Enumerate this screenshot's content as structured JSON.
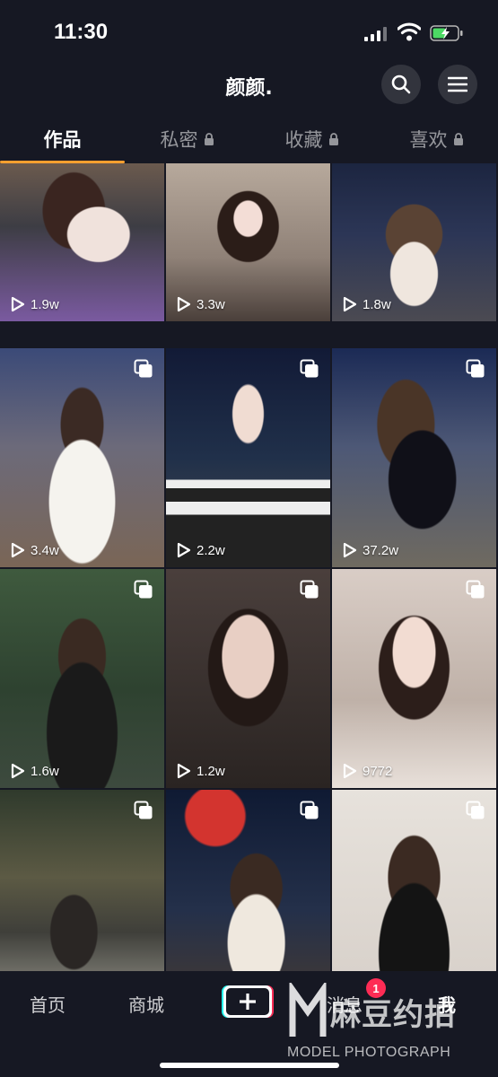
{
  "status_bar": {
    "time": "11:30"
  },
  "header": {
    "title": "颜颜."
  },
  "tabs": [
    {
      "label": "作品",
      "locked": false
    },
    {
      "label": "私密",
      "locked": true
    },
    {
      "label": "收藏",
      "locked": true
    },
    {
      "label": "喜欢",
      "locked": true
    }
  ],
  "videos": [
    {
      "views": "1.9w",
      "multi": false
    },
    {
      "views": "3.3w",
      "multi": false
    },
    {
      "views": "1.8w",
      "multi": false
    },
    {
      "views": "3.4w",
      "multi": true
    },
    {
      "views": "2.2w",
      "multi": true
    },
    {
      "views": "37.2w",
      "multi": true
    },
    {
      "views": "1.6w",
      "multi": true
    },
    {
      "views": "1.2w",
      "multi": true
    },
    {
      "views": "9772",
      "multi": true
    },
    {
      "views": "",
      "multi": true
    },
    {
      "views": "",
      "multi": true
    },
    {
      "views": "",
      "multi": true
    }
  ],
  "bottom_nav": {
    "home": "首页",
    "mall": "商城",
    "messages": "消息",
    "messages_badge": "1",
    "me": "我"
  },
  "watermark": {
    "cn": "麻豆约拍",
    "en": "MODEL PHOTOGRAPH"
  },
  "colors": {
    "background": "#161823",
    "accent": "#fe9f2f",
    "badge": "#fe2c55"
  }
}
